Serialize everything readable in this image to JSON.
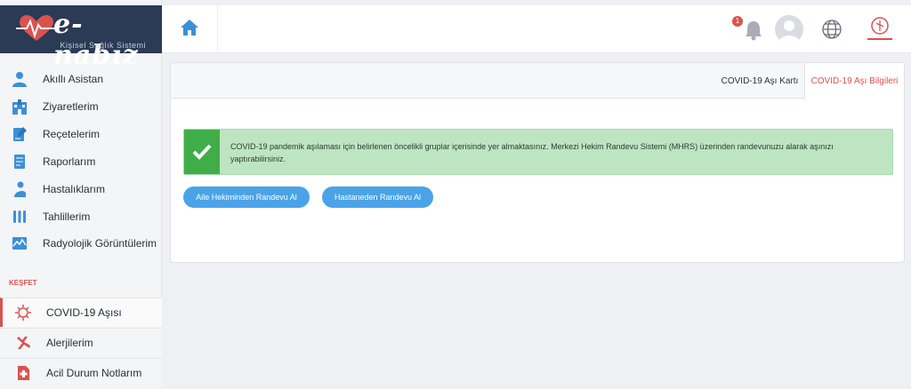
{
  "brand": {
    "title": "e-nabız",
    "subtitle": "Kişisel Sağlık Sistemi"
  },
  "sidebar": {
    "items": [
      {
        "label": "Akıllı Asistan",
        "icon": "person-icon"
      },
      {
        "label": "Ziyaretlerim",
        "icon": "hospital-icon"
      },
      {
        "label": "Reçetelerim",
        "icon": "prescription-icon"
      },
      {
        "label": "Raporlarım",
        "icon": "report-icon"
      },
      {
        "label": "Hastalıklarım",
        "icon": "patient-icon"
      },
      {
        "label": "Tahlillerim",
        "icon": "test-tubes-icon"
      },
      {
        "label": "Radyolojik Görüntülerim",
        "icon": "radiology-icon"
      }
    ],
    "section_label": "KEŞFET",
    "discover": [
      {
        "label": "COVID-19 Aşısı",
        "icon": "virus-icon",
        "active": true
      },
      {
        "label": "Alerjilerim",
        "icon": "allergy-icon",
        "active": false
      },
      {
        "label": "Acil Durum Notlarım",
        "icon": "emergency-notes-icon",
        "active": false
      }
    ]
  },
  "topbar": {
    "notification_count": "1"
  },
  "tabs": [
    {
      "label": "COVID-19 Aşı Kartı",
      "active": false
    },
    {
      "label": "COVID-19 Aşı Bilgileri",
      "active": true
    }
  ],
  "alert": {
    "message": "COVID-19 pandemik aşılaması için belirlenen öncelikli gruplar içerisinde yer almaktasınız. Merkezi Hekim Randevu Sistemi (MHRS) üzerinden randevunuzu alarak aşınızı yaptırabilirsiniz."
  },
  "buttons": {
    "family_doctor": "Aile Hekiminden Randevu Al",
    "hospital": "Hastaneden Randevu Al"
  },
  "colors": {
    "accent": "#d9534f",
    "brand": "#2b3a55",
    "success": "#3fae49",
    "button": "#4aa3e8"
  }
}
